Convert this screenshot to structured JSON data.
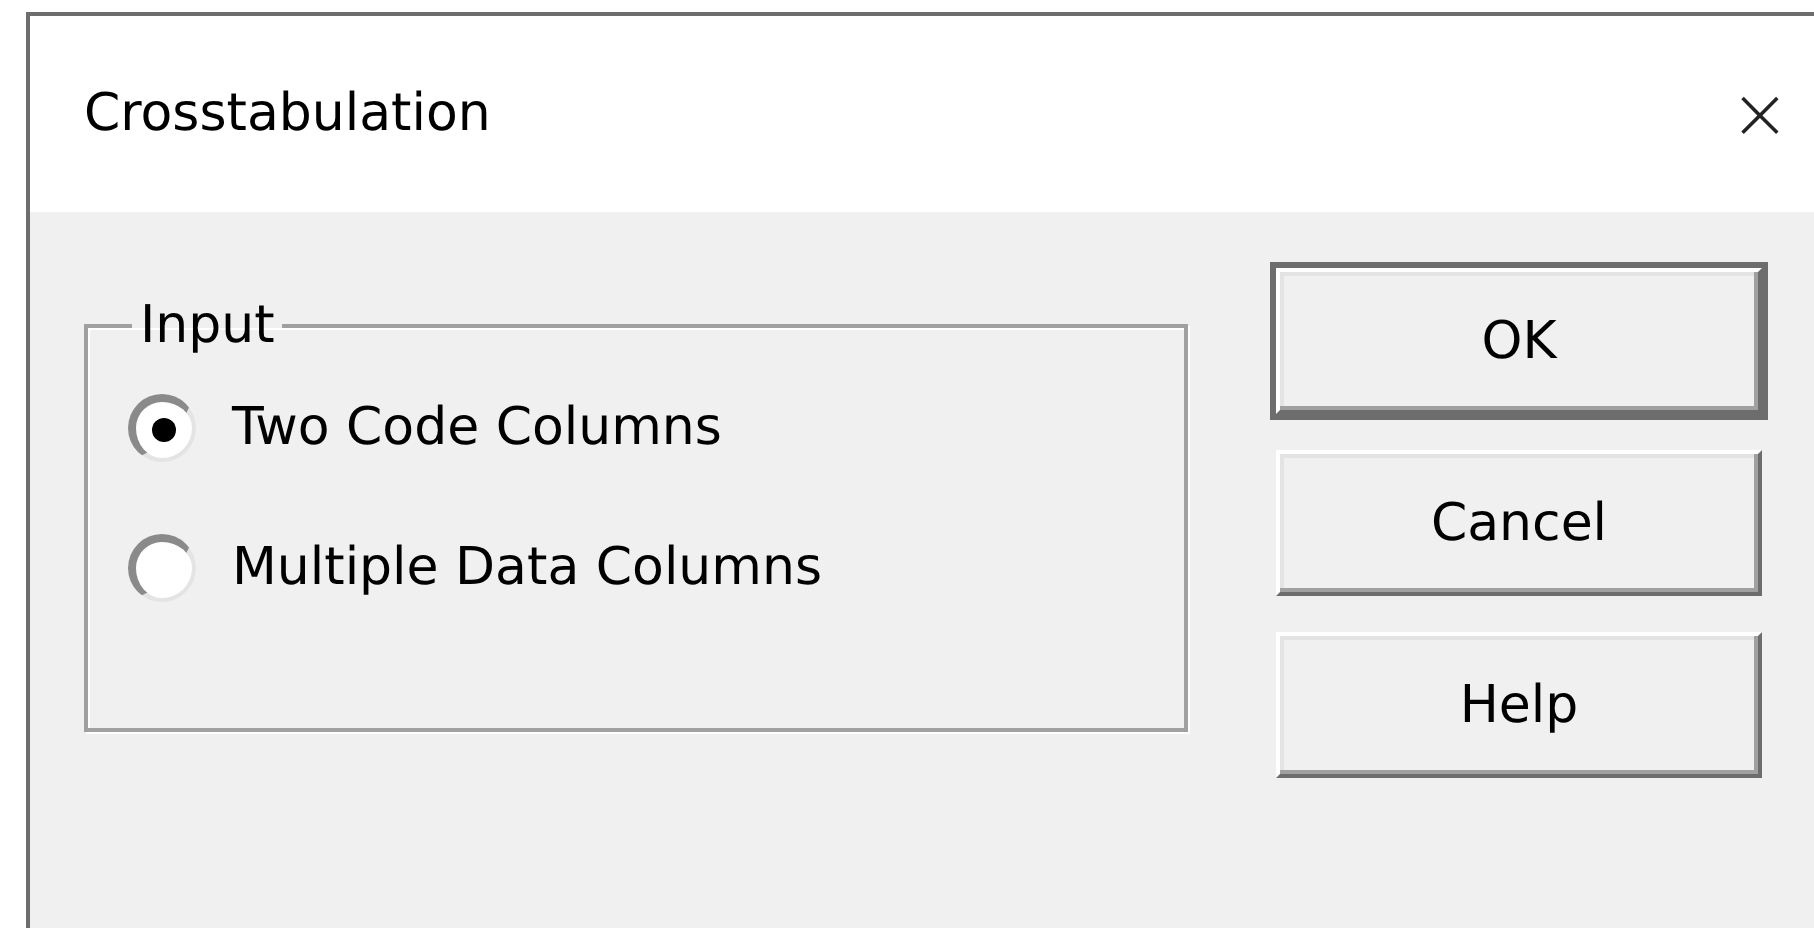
{
  "window": {
    "title": "Crosstabulation",
    "close": "×"
  },
  "input_group": {
    "label": "Input",
    "options": [
      {
        "label": "Two Code Columns",
        "selected": true
      },
      {
        "label": "Multiple Data Columns",
        "selected": false
      }
    ]
  },
  "buttons": [
    {
      "label": "OK",
      "default": true
    },
    {
      "label": "Cancel",
      "default": false
    },
    {
      "label": "Help",
      "default": false
    }
  ]
}
